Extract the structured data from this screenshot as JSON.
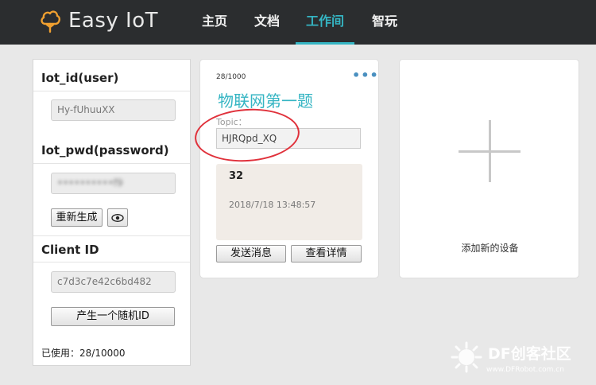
{
  "app": {
    "brand": "Easy IoT",
    "brand_icon": "cloud-tree-icon",
    "accent": "#35b5c3"
  },
  "nav": {
    "items": [
      {
        "label": "主页",
        "active": false
      },
      {
        "label": "文档",
        "active": false
      },
      {
        "label": "工作间",
        "active": true
      },
      {
        "label": "智玩",
        "active": false
      }
    ]
  },
  "credentials": {
    "user_label": "Iot_id(user)",
    "user_value": "Hy-fUhuuXX",
    "pwd_label": "Iot_pwd(password)",
    "pwd_value": "••••••••••f9",
    "regenerate_label": "重新生成",
    "reveal_icon": "eye-icon",
    "client_label": "Client ID",
    "client_value": "c7d3c7e42c6bd482",
    "random_id_label": "产生一个随机ID",
    "usage": "已使用：28/10000"
  },
  "device": {
    "counter": "28/1000",
    "menu_icon": "more-dots-icon",
    "title": "物联网第一题",
    "topic_label": "Topic：",
    "topic_value": "HJRQpd_XQ",
    "last_message": "32",
    "last_time": "2018/7/18 13:48:57",
    "send_label": "发送消息",
    "details_label": "查看详情"
  },
  "add_device": {
    "label": "添加新的设备",
    "icon": "plus-icon"
  },
  "watermark": {
    "text": "DF创客社区",
    "url": "www.DFRobot.com.cn"
  }
}
